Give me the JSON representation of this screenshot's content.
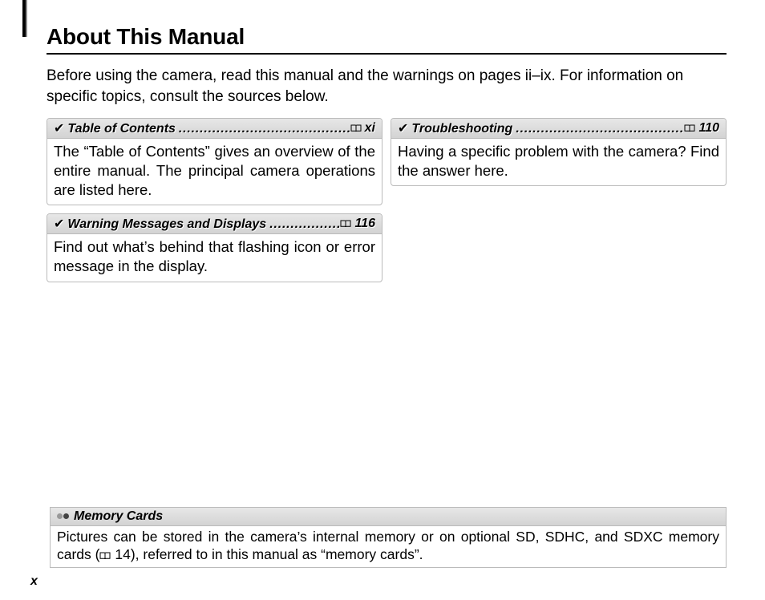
{
  "title": "About This Manual",
  "intro": "Before using the camera, read this manual and the warnings on pages ii–ix.  For information on specific topics, consult the sources below.",
  "cards": [
    {
      "heading": "Table of Contents",
      "page": "xi",
      "body": "The “Table of Contents” gives an overview of the entire manual.  The principal camera operations are listed here."
    },
    {
      "heading": "Troubleshooting",
      "page": "110",
      "body": "Having a specific problem with the camera? Find the answer here."
    },
    {
      "heading": "Warning Messages and Displays",
      "page": "116",
      "body": "Find out what’s behind that flashing icon or error message in the display."
    }
  ],
  "note": {
    "title": "Memory Cards",
    "body_pre": "Pictures can be stored in the camera’s internal memory or on optional SD, SDHC, and SDXC memory cards (",
    "page_ref": "14",
    "body_post": "), referred to in this manual as “memory cards”."
  },
  "page_number": "x"
}
